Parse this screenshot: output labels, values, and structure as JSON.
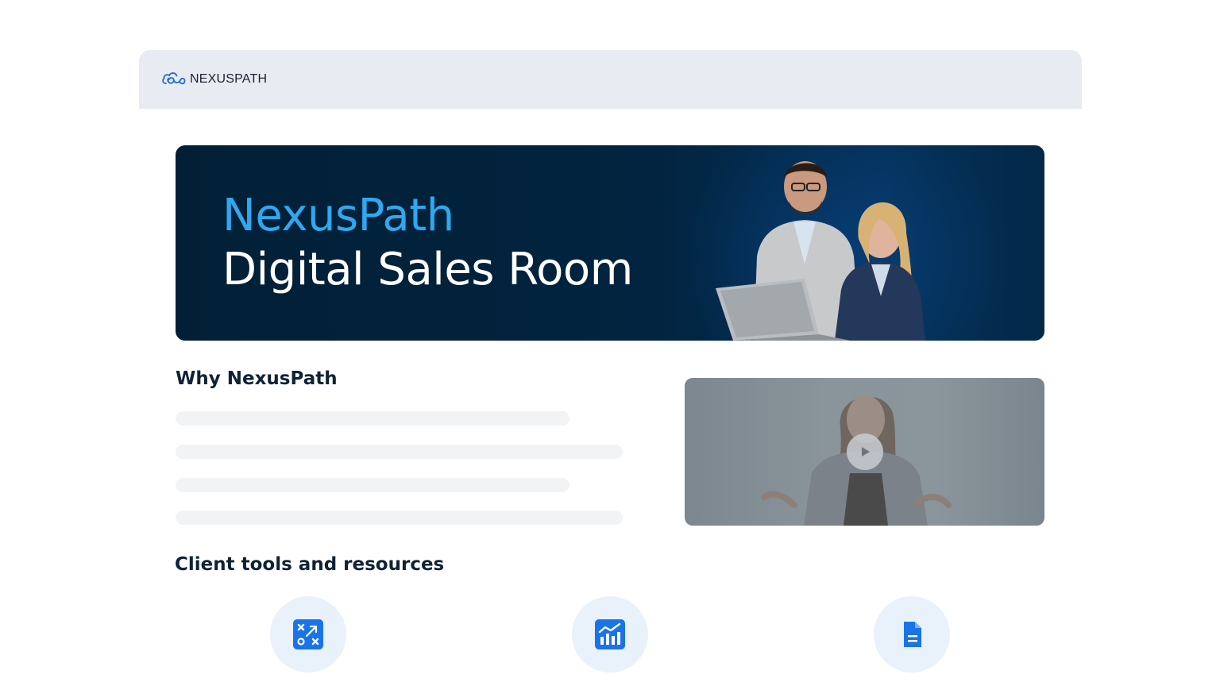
{
  "header": {
    "logo_text": "NEXUSPATH",
    "logo_icon": "cloud-infinity-icon"
  },
  "hero": {
    "title": "NexusPath",
    "subtitle": "Digital Sales Room",
    "title_color": "#2ea9f0",
    "background": "#021f36"
  },
  "why": {
    "title": "Why NexusPath"
  },
  "video": {
    "play_icon": "play-icon"
  },
  "tools": {
    "title": "Client tools and resources",
    "items": [
      {
        "icon": "strategy-icon"
      },
      {
        "icon": "chart-icon"
      },
      {
        "icon": "document-icon"
      }
    ],
    "accent": "#1a73e8"
  }
}
